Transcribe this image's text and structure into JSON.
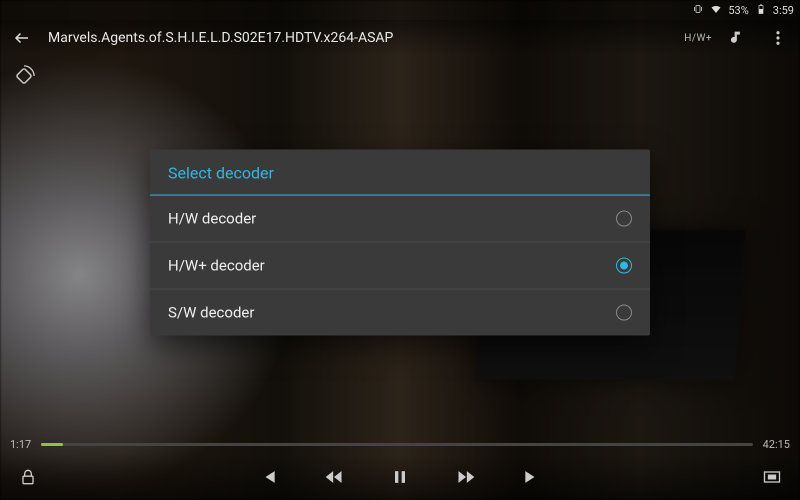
{
  "status_bar": {
    "battery_text": "53%",
    "clock": "3:59"
  },
  "player": {
    "title": "Marvels.Agents.of.S.H.I.E.L.D.S02E17.HDTV.x264-ASAP",
    "decoder_badge": "H/W+",
    "elapsed": "1:17",
    "duration": "42:15"
  },
  "dialog": {
    "title": "Select decoder",
    "options": [
      {
        "label": "H/W decoder",
        "selected": false
      },
      {
        "label": "H/W+ decoder",
        "selected": true
      },
      {
        "label": "S/W decoder",
        "selected": false
      }
    ]
  }
}
